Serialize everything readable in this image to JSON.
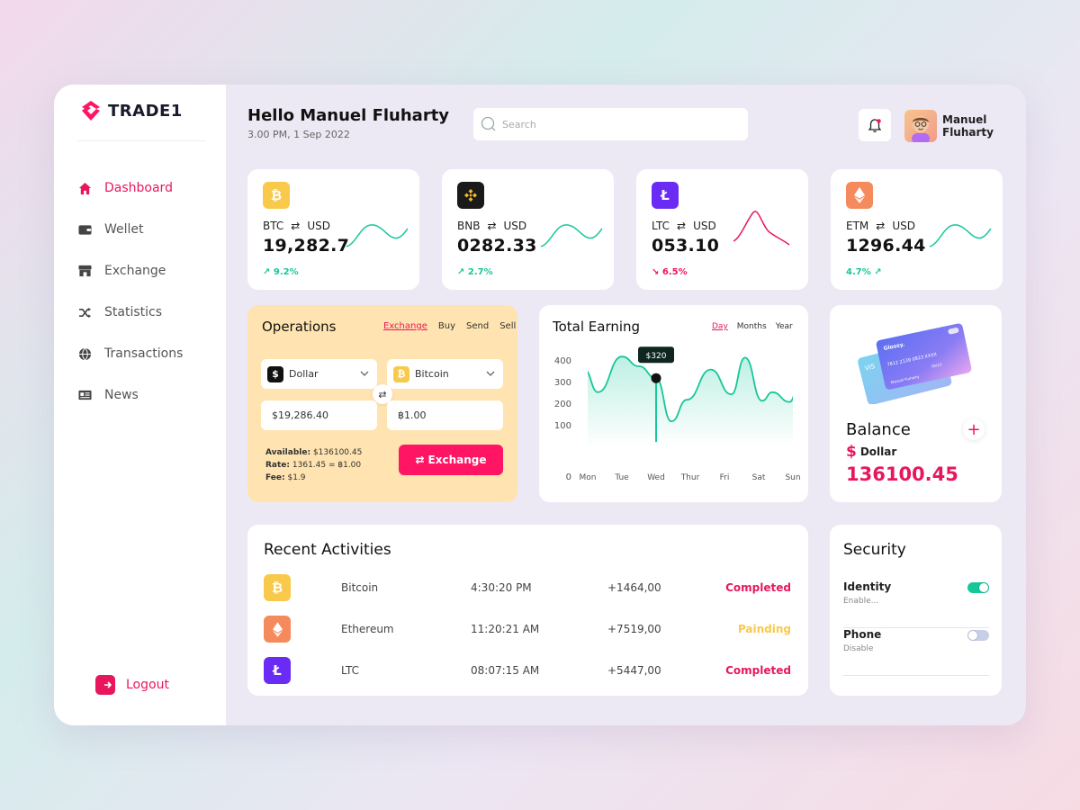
{
  "brand": {
    "name": "TRADE1"
  },
  "nav": [
    {
      "label": "Dashboard",
      "icon": "home-icon",
      "active": true
    },
    {
      "label": "Wellet",
      "icon": "wallet-icon"
    },
    {
      "label": "Exchange",
      "icon": "store-icon"
    },
    {
      "label": "Statistics",
      "icon": "shuffle-icon"
    },
    {
      "label": "Transactions",
      "icon": "globe-icon"
    },
    {
      "label": "News",
      "icon": "newspaper-icon"
    }
  ],
  "logout_label": "Logout",
  "header": {
    "greeting": "Hello Manuel Fluharty",
    "datetime": "3.00 PM, 1 Sep 2022",
    "search_placeholder": "Search",
    "user_name": "Manuel Fluharty"
  },
  "coins": [
    {
      "symbol": "BTC",
      "quote": "USD",
      "price": "19,282.7",
      "change": "9.2%",
      "direction": "up",
      "icon": "bitcoin-icon",
      "color": "#f8c94a",
      "spark_color": "#16c79a"
    },
    {
      "symbol": "BNB",
      "quote": "USD",
      "price": "0282.33",
      "change": "2.7%",
      "direction": "up",
      "icon": "binance-icon",
      "color": "#1a1a1a",
      "spark_color": "#16c79a"
    },
    {
      "symbol": "LTC",
      "quote": "USD",
      "price": "053.10",
      "change": "6.5%",
      "direction": "down",
      "icon": "litecoin-icon",
      "color": "#6a2cf5",
      "spark_color": "#e8175d"
    },
    {
      "symbol": "ETM",
      "quote": "USD",
      "price": "1296.44",
      "change": "4.7%",
      "direction": "up",
      "icon": "ethereum-icon",
      "color": "#f58a5c",
      "spark_color": "#16c79a"
    }
  ],
  "operations": {
    "title": "Operations",
    "tabs": [
      "Exchange",
      "Buy",
      "Send",
      "Sell"
    ],
    "active_tab": "Exchange",
    "from_currency": "Dollar",
    "to_currency": "Bitcoin",
    "from_amount": "$19,286.40",
    "to_amount": "฿1.00",
    "available_label": "Available:",
    "available_value": "$136100.45",
    "rate_label": "Rate:",
    "rate_value": "1361.45 = ฿1.00",
    "fee_label": "Fee:",
    "fee_value": "$1.9",
    "button_label": "Exchange"
  },
  "earning": {
    "title": "Total Earning",
    "tabs": [
      "Day",
      "Months",
      "Year"
    ],
    "active_tab": "Day",
    "tooltip": "$320"
  },
  "chart_data": {
    "type": "area",
    "title": "Total Earning",
    "categories": [
      "Mon",
      "Tue",
      "Wed",
      "Thur",
      "Fri",
      "Sat",
      "Sun"
    ],
    "yticks": [
      0,
      100,
      200,
      300,
      400
    ],
    "ylim": [
      0,
      450
    ],
    "x": [
      -0.1,
      0.3,
      1,
      1.5,
      2,
      2.45,
      2.9,
      3.6,
      4.2,
      4.6,
      5.1,
      5.4,
      5.9,
      6.2
    ],
    "values": [
      360,
      255,
      420,
      375,
      320,
      120,
      220,
      360,
      245,
      415,
      215,
      255,
      210,
      295
    ],
    "highlight": {
      "category": "Wed",
      "value": 320,
      "label": "$320"
    },
    "grid": false,
    "legend": "none"
  },
  "balance": {
    "title": "Balance",
    "currency": "Dollar",
    "amount": "136100.45",
    "card_brand": "Glossy.",
    "card_number": "7812 2139 0823 XXXX",
    "card_exp": "05/23",
    "card_holder": "Manuel Fluharty",
    "back_card_brand": "VIS"
  },
  "recent": {
    "title": "Recent Activities",
    "rows": [
      {
        "icon": "bitcoin-icon",
        "color": "#f8c94a",
        "name": "Bitcoin",
        "time": "4:30:20 PM",
        "amount": "+1464,00",
        "status": "Completed",
        "status_class": "st-completed"
      },
      {
        "icon": "ethereum-icon",
        "color": "#f58a5c",
        "name": "Ethereum",
        "time": "11:20:21 AM",
        "amount": "+7519,00",
        "status": "Painding",
        "status_class": "st-pending"
      },
      {
        "icon": "litecoin-icon",
        "color": "#6a2cf5",
        "name": "LTC",
        "time": "08:07:15 AM",
        "amount": "+5447,00",
        "status": "Completed",
        "status_class": "st-completed"
      }
    ]
  },
  "security": {
    "title": "Security",
    "items": [
      {
        "label": "Identity",
        "sub": "Enable...",
        "enabled": true
      },
      {
        "label": "Phone",
        "sub": "Disable",
        "enabled": false
      }
    ]
  }
}
